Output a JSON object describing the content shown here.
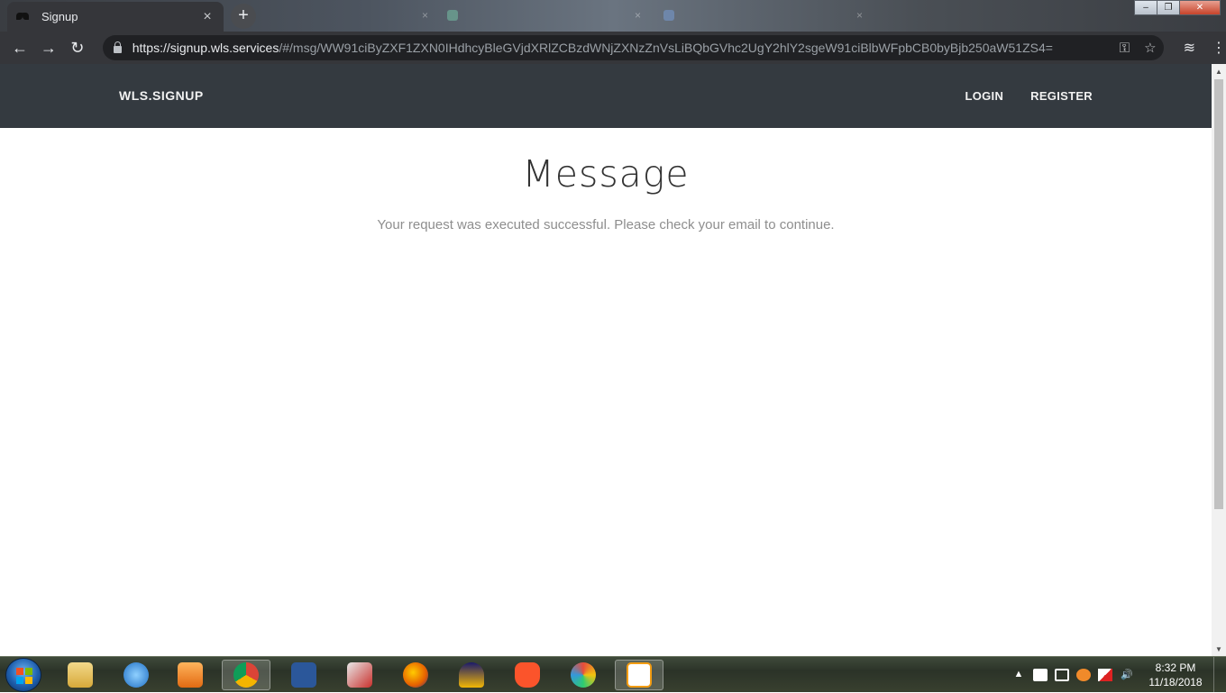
{
  "browser": {
    "active_tab": {
      "title": "Signup",
      "close": "×"
    },
    "new_tab": "+",
    "background_tabs": [],
    "window_controls": {
      "minimize": "–",
      "maximize": "❐",
      "close": "✕"
    },
    "nav": {
      "back": "←",
      "forward": "→",
      "reload": "↻"
    },
    "url": {
      "host": "https://signup.wls.services",
      "path": "/#/msg/WW91ciByZXF1ZXN0IHdhcyBleGVjdXRlZCBzdWNjZXNzZnVsLiBQbGVhc2UgY2hlY2sgeW91ciBlbWFpbCB0byBjb250aW51ZS4="
    },
    "omnibox_icons": {
      "key": "⚿",
      "star": "☆"
    },
    "toolbar_icons": {
      "extensions": "≋",
      "menu": "⋮"
    }
  },
  "site": {
    "brand": "WLS.SIGNUP",
    "nav": {
      "login": "LOGIN",
      "register": "REGISTER"
    },
    "message": {
      "title": "Message",
      "text": "Your request was executed successful. Please check your email to continue."
    }
  },
  "scrollbar": {
    "up": "▲",
    "down": "▼"
  },
  "taskbar": {
    "apps": [
      {
        "name": "file-explorer",
        "color": "#e8c46a"
      },
      {
        "name": "internet-explorer",
        "color": "#2a7fd4"
      },
      {
        "name": "media-player",
        "color": "#f08a2a"
      },
      {
        "name": "chrome",
        "color": "#db4437"
      },
      {
        "name": "word",
        "color": "#2b579a"
      },
      {
        "name": "snipping-tool",
        "color": "#c9302c"
      },
      {
        "name": "firefox",
        "color": "#e66000"
      },
      {
        "name": "audio-app",
        "color": "#f2b705"
      },
      {
        "name": "brave",
        "color": "#fb542b"
      },
      {
        "name": "paint",
        "color": "#7fb3d5"
      },
      {
        "name": "sun-broadband",
        "color": "#ffffff"
      }
    ],
    "tray": {
      "show_hidden": "▲"
    },
    "clock": {
      "time": "8:32 PM",
      "date": "11/18/2018"
    }
  }
}
